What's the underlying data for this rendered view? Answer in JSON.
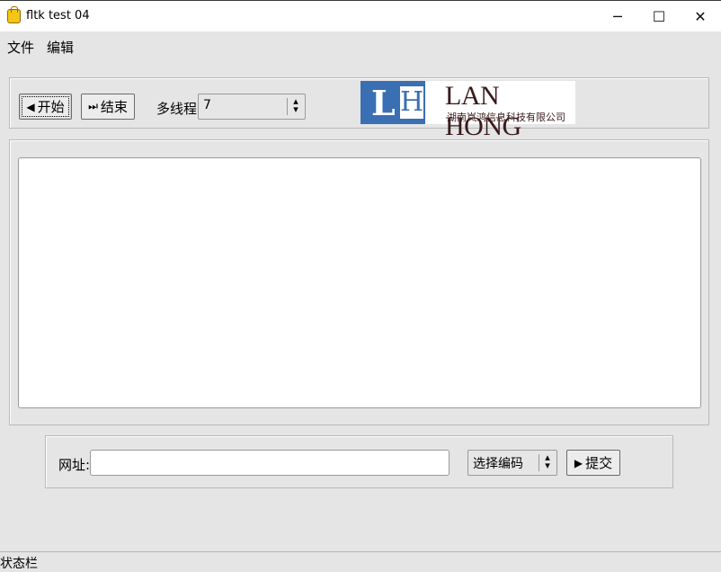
{
  "window": {
    "title": "fltk test 04",
    "controls": {
      "minimize": "─",
      "maximize": "☐",
      "close": "✕"
    }
  },
  "menu": {
    "file": "文件",
    "edit": "编辑"
  },
  "toolbar": {
    "start_label": "开始",
    "start_icon": "◀",
    "end_label": "结束",
    "end_icon": "⏭",
    "threads_label": "多线程",
    "threads_value": "7"
  },
  "logo": {
    "letter_l": "L",
    "letter_h": "H",
    "name": "LAN HONG",
    "company": "湖南岚鸿信息科技有限公司"
  },
  "form": {
    "url_label": "网址:",
    "url_value": "",
    "encoding_label": "选择编码",
    "submit_label": "提交",
    "submit_icon": "▶"
  },
  "statusbar": {
    "text": "状态栏"
  }
}
